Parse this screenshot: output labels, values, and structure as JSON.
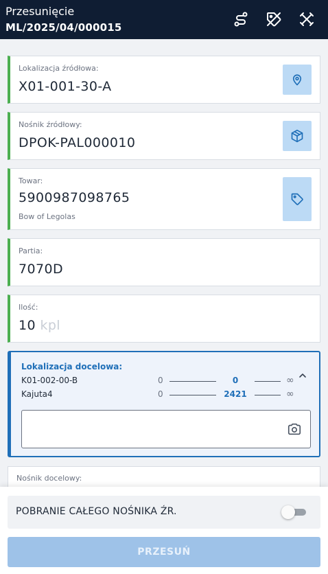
{
  "header": {
    "title": "Przesunięcie",
    "document_number": "ML/2025/04/000015",
    "icons": [
      "route-icon",
      "tag-off-icon",
      "close-cross-icon"
    ]
  },
  "fields": {
    "source_location": {
      "label": "Lokalizacja źródłowa:",
      "value": "X01-001-30-A",
      "button_icon": "map-pin-icon"
    },
    "source_carrier": {
      "label": "Nośnik źródłowy:",
      "value": "DPOK-PAL000010",
      "button_icon": "package-icon"
    },
    "item": {
      "label": "Towar:",
      "value": "5900987098765",
      "description": "Bow of Legolas",
      "button_icon": "tag-icon"
    },
    "batch": {
      "label": "Partia:",
      "value": "7070D"
    },
    "quantity": {
      "label": "Ilość:",
      "value": "10",
      "unit": "kpl"
    }
  },
  "destination": {
    "label": "Lokalizacja docelowa:",
    "rows": [
      {
        "name": "K01-002-00-B",
        "min": "0",
        "value": "0",
        "max": "∞"
      },
      {
        "name": "Kajuta4",
        "min": "0",
        "value": "2421",
        "max": "∞"
      }
    ],
    "input_value": "",
    "icons": [
      "chevron-up-icon",
      "camera-icon"
    ]
  },
  "dest_carrier": {
    "label": "Nośnik docelowy:"
  },
  "bottom": {
    "toggle_label": "POBRANIE CAŁEGO NOŚNIKA ŹR.",
    "toggle_on": false,
    "action_label": "PRZESUŃ"
  },
  "colors": {
    "header_bg": "#0f1d33",
    "accent_green": "#4caf50",
    "accent_blue": "#1f6fb8",
    "icon_button_bg": "#bcdaf5",
    "action_button_bg": "#9ec2e8"
  }
}
